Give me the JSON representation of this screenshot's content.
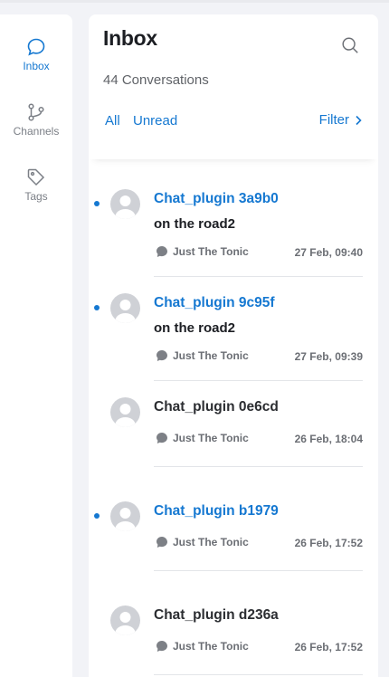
{
  "sidebar": {
    "items": [
      {
        "label": "Inbox",
        "icon": "chat-bubble-icon",
        "active": true
      },
      {
        "label": "Channels",
        "icon": "branch-icon",
        "active": false
      },
      {
        "label": "Tags",
        "icon": "tag-icon",
        "active": false
      }
    ]
  },
  "header": {
    "title": "Inbox",
    "count": "44 Conversations",
    "tabs": [
      "All",
      "Unread"
    ],
    "filter_label": "Filter"
  },
  "conversations": [
    {
      "name": "Chat_plugin 3a9b0",
      "preview": "on the road2",
      "source": "Just The Tonic",
      "time": "27 Feb, 09:40",
      "unread": true
    },
    {
      "name": "Chat_plugin 9c95f",
      "preview": "on the road2",
      "source": "Just The Tonic",
      "time": "27 Feb, 09:39",
      "unread": true
    },
    {
      "name": "Chat_plugin 0e6cd",
      "preview": "",
      "source": "Just The Tonic",
      "time": "26 Feb, 18:04",
      "unread": false
    },
    {
      "name": "Chat_plugin b1979",
      "preview": "",
      "source": "Just The Tonic",
      "time": "26 Feb, 17:52",
      "unread": true
    },
    {
      "name": "Chat_plugin d236a",
      "preview": "",
      "source": "Just The Tonic",
      "time": "26 Feb, 17:52",
      "unread": false
    }
  ],
  "colors": {
    "accent": "#1578d1",
    "background": "#f2f3f7",
    "text_muted": "#6b6e74"
  }
}
